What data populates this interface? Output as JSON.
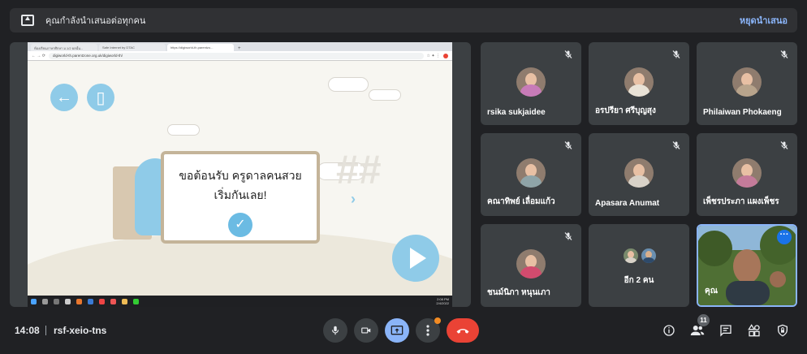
{
  "banner": {
    "text": "คุณกำลังนำเสนอต่อทุกคน",
    "stop_label": "หยุดนำเสนอ"
  },
  "shared_screen": {
    "tabs": [
      "ห้องเรียนภาษาศึกษา ม.1/2 ผลนั้น...",
      "Safe Internet by DTAC",
      "https://digiworld-th.parentzo..."
    ],
    "url": "digiworld-th.parentzone.org.uk/digiworld-th/",
    "dialog_line1": "ขอต้อนรับ ครูดาลคนสวย",
    "dialog_line2": "เริ่มกันเลย!",
    "ghost_text": "##",
    "taskbar_time": "2:08 PM",
    "taskbar_date": "2/4/2022"
  },
  "participants": [
    {
      "name": "rsika sukjaidee",
      "muted": true,
      "shirt": "#c77bb8"
    },
    {
      "name": "อรปรียา ศรีบุญสุง",
      "muted": true,
      "shirt": "#e9e2d6"
    },
    {
      "name": "Philaiwan Phokaeng",
      "muted": true,
      "shirt": "#b8a48c"
    },
    {
      "name": "คณาทิพย์ เลื่อมแก้ว",
      "muted": true,
      "shirt": "#8fa4a8"
    },
    {
      "name": "Apasara Anumat",
      "muted": true,
      "shirt": "#d8d2c8"
    },
    {
      "name": "เพ็ชรประภา แผงเพ็ชร",
      "muted": true,
      "shirt": "#c47b9a"
    },
    {
      "name": "ชนม์นิภา หนุนเภา",
      "muted": true,
      "shirt": "#d24b6e"
    }
  ],
  "more_tile": {
    "label": "อีก 2 คน"
  },
  "self_tile": {
    "name": "คุณ"
  },
  "bottom_bar": {
    "time": "14:08",
    "meeting_code": "rsf-xeio-tns",
    "participant_count": "11"
  },
  "colors": {
    "background": "#202124",
    "tile": "#3c4043",
    "accent": "#8ab4f8",
    "hangup": "#ea4335"
  }
}
